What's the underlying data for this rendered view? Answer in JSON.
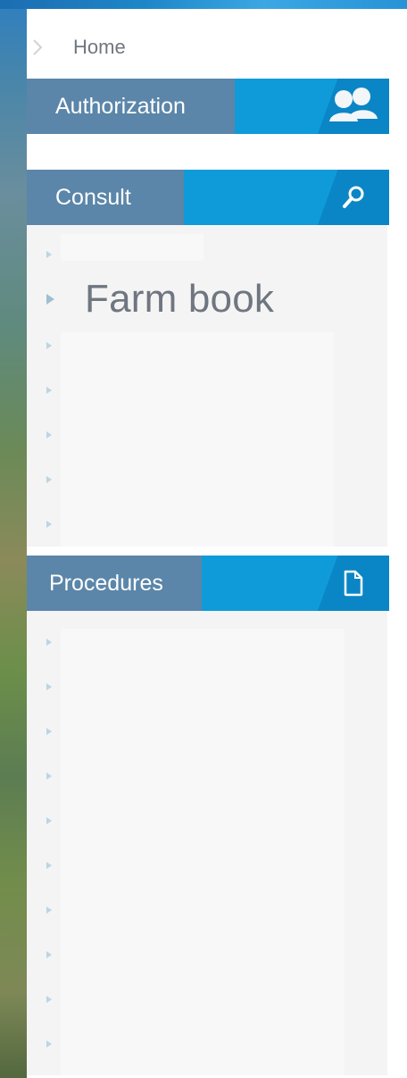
{
  "breadcrumb": {
    "label": "Home"
  },
  "authorization": {
    "label": "Authorization",
    "icon": "users-icon"
  },
  "consult": {
    "label": "Consult",
    "icon": "search-icon",
    "items": [
      "",
      "Farm book",
      "",
      "",
      "",
      "",
      ""
    ]
  },
  "procedures": {
    "label": "Procedures",
    "icon": "document-icon",
    "items": [
      "",
      "",
      "",
      "",
      "",
      "",
      "",
      "",
      "",
      ""
    ]
  }
}
